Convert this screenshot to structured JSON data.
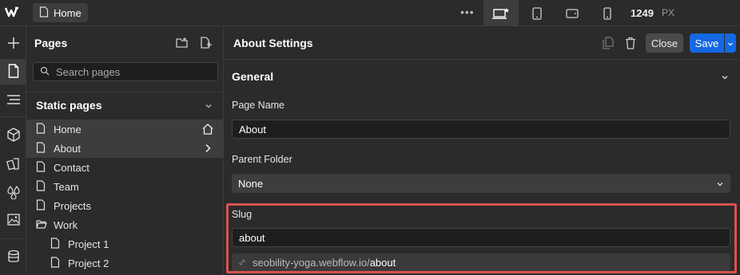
{
  "topbar": {
    "logo_icon": "webflow-logo-icon",
    "current_page": "Home",
    "more_icon": "more-dots-icon",
    "width_value": "1249",
    "width_unit": "PX",
    "breakpoints": [
      "desktop-base-icon",
      "tablet-icon",
      "mobile-landscape-icon",
      "mobile-portrait-icon"
    ]
  },
  "toolbar": {
    "tools": [
      "add-icon",
      "pages-icon",
      "navigator-icon",
      "components-icon",
      "style-selectors-icon",
      "variables-icon",
      "assets-icon",
      "cms-icon"
    ]
  },
  "pages_panel": {
    "title": "Pages",
    "search_placeholder": "Search pages",
    "section_title": "Static pages",
    "items": [
      {
        "label": "Home",
        "type": "page"
      },
      {
        "label": "About",
        "type": "page"
      },
      {
        "label": "Contact",
        "type": "page"
      },
      {
        "label": "Team",
        "type": "page"
      },
      {
        "label": "Projects",
        "type": "page"
      },
      {
        "label": "Work",
        "type": "folder"
      },
      {
        "label": "Project 1",
        "type": "page"
      },
      {
        "label": "Project 2",
        "type": "page"
      }
    ]
  },
  "settings": {
    "title": "About Settings",
    "close_label": "Close",
    "save_label": "Save",
    "section_title": "General",
    "page_name_label": "Page Name",
    "page_name_value": "About",
    "parent_folder_label": "Parent Folder",
    "parent_folder_value": "None",
    "slug_label": "Slug",
    "slug_value": "about",
    "url_domain": "seobility-yoga.webflow.io/",
    "url_path": "about"
  },
  "colors": {
    "accent": "#1468e3",
    "highlight": "#d9534f"
  }
}
